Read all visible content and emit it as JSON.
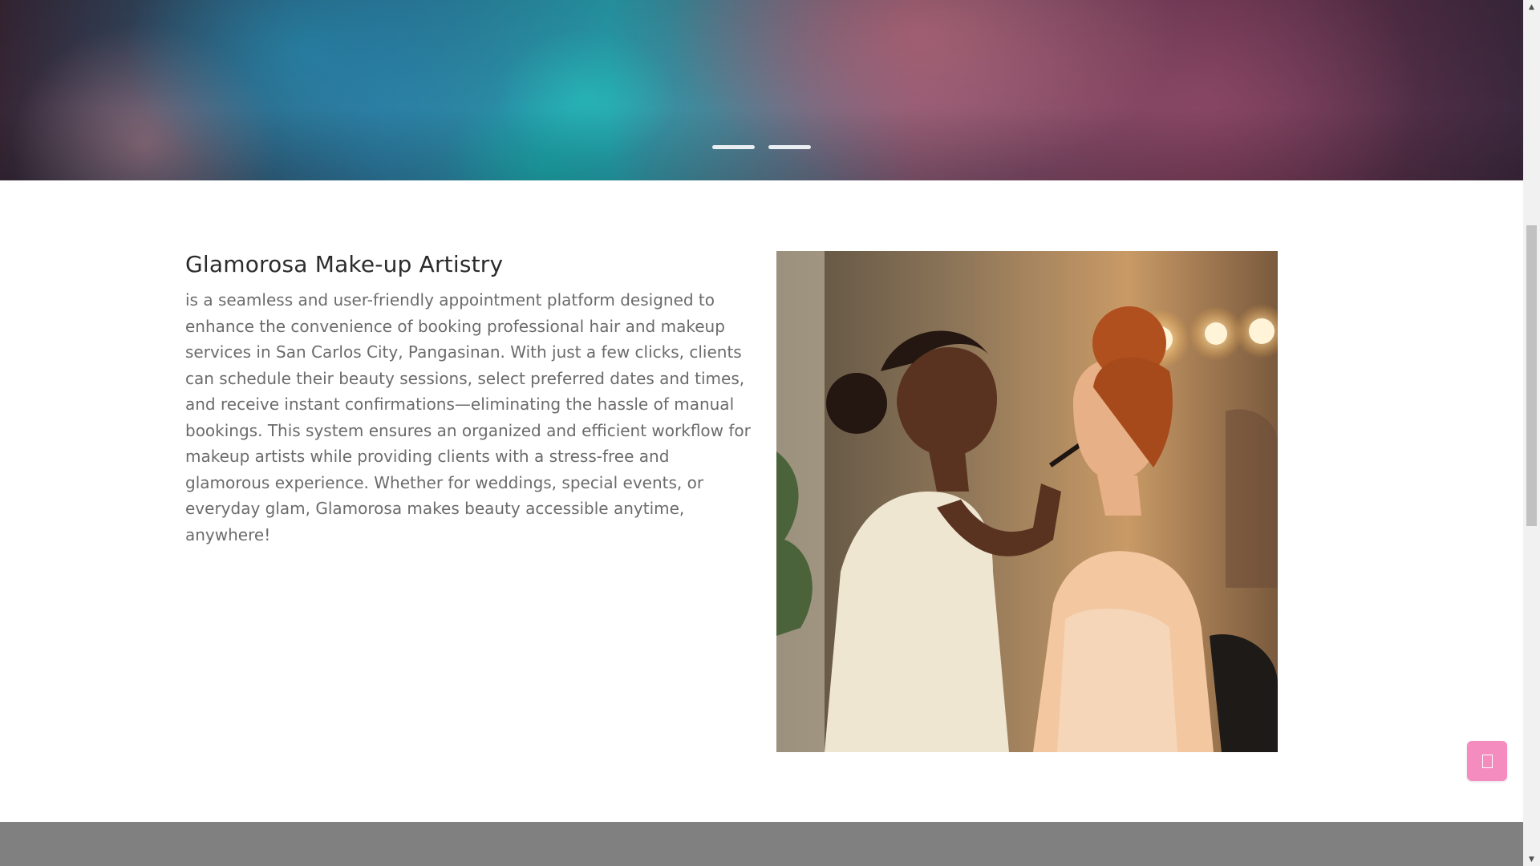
{
  "hero": {
    "slides": [
      {
        "label": "slide-1"
      },
      {
        "label": "slide-2"
      }
    ]
  },
  "about": {
    "title": "Glamorosa Make-up Artistry",
    "body": "is a seamless and user-friendly appointment platform designed to enhance the convenience of booking professional hair and makeup services in San Carlos City, Pangasinan. With just a few clicks, clients can schedule their beauty sessions, select preferred dates and times, and receive instant confirmations—eliminating the hassle of manual bookings. This system ensures an organized and efficient workflow for makeup artists while providing clients with a stress-free and glamorous experience. Whether for weddings, special events, or everyday glam, Glamorosa makes beauty accessible anytime, anywhere!",
    "image_alt": "Makeup artist applying makeup to a client"
  },
  "float_button": {
    "icon": "square-outline-icon"
  },
  "scrollbar": {
    "up_arrow": "▲",
    "down_arrow": "▼"
  },
  "colors": {
    "accent_pink": "#f48cc0",
    "footer_gray": "#808080",
    "body_text": "#6b6b6b",
    "title_text": "#2b2b2b"
  }
}
